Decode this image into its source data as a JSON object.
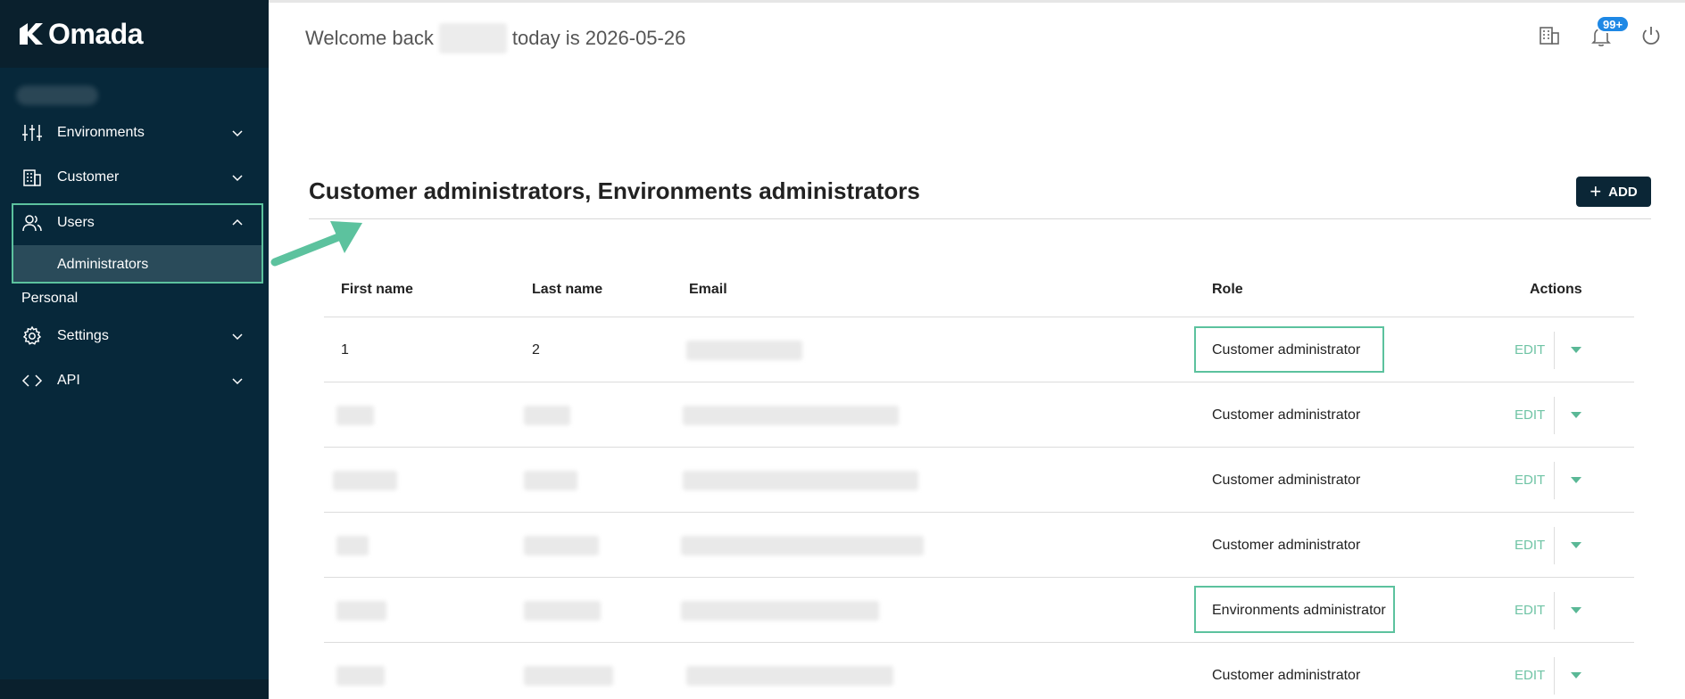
{
  "brand": {
    "name": "Omada"
  },
  "header": {
    "welcome_prefix": "Welcome back",
    "welcome_suffix": "today is 2026-05-26",
    "notifications_badge": "99+"
  },
  "sidebar": {
    "items": [
      {
        "label": "Environments",
        "icon": "sliders-icon",
        "chevron": "chevron-down"
      },
      {
        "label": "Customer",
        "icon": "building-icon",
        "chevron": "chevron-down"
      },
      {
        "label": "Users",
        "icon": "users-icon",
        "chevron": "chevron-up"
      },
      {
        "label": "Settings",
        "icon": "gear-icon",
        "chevron": "chevron-down"
      },
      {
        "label": "API",
        "icon": "code-icon",
        "chevron": "chevron-down"
      }
    ],
    "sub_item": "Administrators",
    "section_label": "Personal"
  },
  "main": {
    "title": "Customer administrators, Environments administrators",
    "add_label": "ADD"
  },
  "table": {
    "columns": [
      "First name",
      "Last name",
      "Email",
      "Role",
      "Actions"
    ],
    "edit_label": "EDIT",
    "rows": [
      {
        "first_name": "1",
        "last_name": "2",
        "role": "Customer administrator"
      },
      {
        "first_name": "",
        "last_name": "",
        "role": "Customer administrator"
      },
      {
        "first_name": "",
        "last_name": "",
        "role": "Customer administrator"
      },
      {
        "first_name": "",
        "last_name": "",
        "role": "Customer administrator"
      },
      {
        "first_name": "",
        "last_name": "",
        "role": "Environments administrator"
      },
      {
        "first_name": "",
        "last_name": "",
        "role": "Customer administrator"
      }
    ]
  },
  "colors": {
    "sidebar_bg": "#07283a",
    "accent_green": "#5cc29e",
    "edit_text": "#6fc4a5",
    "badge_blue": "#1e88e5",
    "add_button": "#0b2636"
  }
}
